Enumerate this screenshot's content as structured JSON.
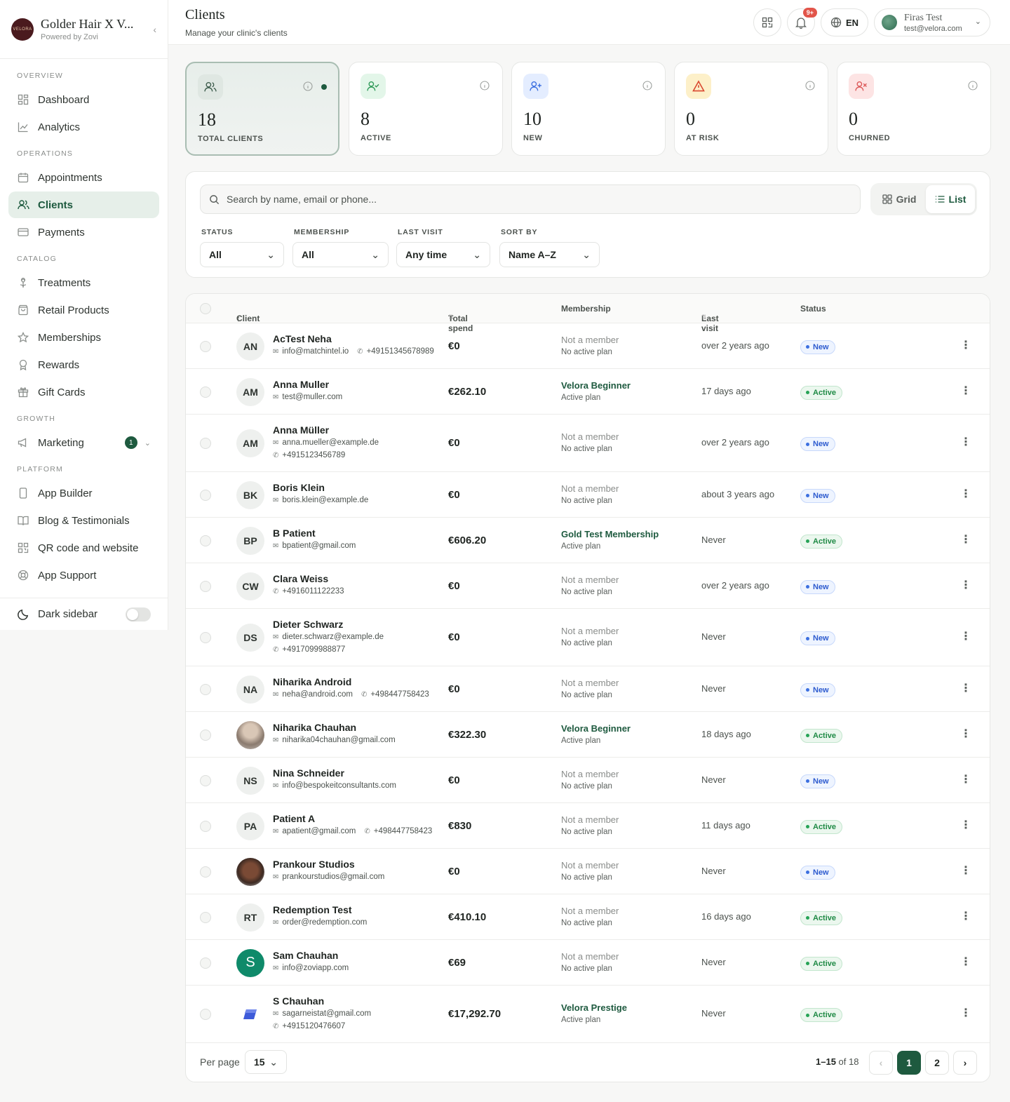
{
  "brand": {
    "logo_text": "VELORA",
    "name": "Golder Hair X V...",
    "sub": "Powered by Zovi"
  },
  "nav": {
    "overview": "OVERVIEW",
    "dashboard": "Dashboard",
    "analytics": "Analytics",
    "operations": "OPERATIONS",
    "appointments": "Appointments",
    "clients": "Clients",
    "payments": "Payments",
    "catalog": "CATALOG",
    "treatments": "Treatments",
    "retail": "Retail Products",
    "memberships": "Memberships",
    "rewards": "Rewards",
    "giftcards": "Gift Cards",
    "growth": "GROWTH",
    "marketing": "Marketing",
    "marketing_badge": "1",
    "platform": "PLATFORM",
    "appbuilder": "App Builder",
    "blog": "Blog & Testimonials",
    "qr": "QR code and website",
    "support": "App Support",
    "dark_sidebar": "Dark sidebar"
  },
  "header": {
    "title": "Clients",
    "subtitle": "Manage your clinic's clients",
    "notif_badge": "9+",
    "lang": "EN",
    "user_name": "Firas Test",
    "user_email": "test@velora.com"
  },
  "stats": [
    {
      "value": "18",
      "label": "TOTAL CLIENTS"
    },
    {
      "value": "8",
      "label": "ACTIVE"
    },
    {
      "value": "10",
      "label": "NEW"
    },
    {
      "value": "0",
      "label": "AT RISK"
    },
    {
      "value": "0",
      "label": "CHURNED"
    }
  ],
  "filters": {
    "search_placeholder": "Search by name, email or phone...",
    "grid_label": "Grid",
    "list_label": "List",
    "status_label": "STATUS",
    "status_value": "All",
    "membership_label": "MEMBERSHIP",
    "membership_value": "All",
    "lastvisit_label": "LAST VISIT",
    "lastvisit_value": "Any time",
    "sort_label": "SORT BY",
    "sort_value": "Name A–Z"
  },
  "table": {
    "headers": {
      "client": "Client",
      "spend": "Total spend",
      "membership": "Membership",
      "last_visit": "Last visit",
      "status": "Status"
    },
    "rows": [
      {
        "initials": "AN",
        "name": "AcTest Neha",
        "email": "info@matchintel.io",
        "phone": "+49151345678989",
        "spend": "€0",
        "mem": "Not a member",
        "plan": "No active plan",
        "visit": "over 2 years ago",
        "status": "New"
      },
      {
        "initials": "AM",
        "name": "Anna Muller",
        "email": "test@muller.com",
        "phone": "",
        "spend": "€262.10",
        "mem": "Velora Beginner",
        "plan": "Active plan",
        "visit": "17 days ago",
        "status": "Active"
      },
      {
        "initials": "AM",
        "name": "Anna Müller",
        "email": "anna.mueller@example.de",
        "phone": "+4915123456789",
        "spend": "€0",
        "mem": "Not a member",
        "plan": "No active plan",
        "visit": "over 2 years ago",
        "status": "New"
      },
      {
        "initials": "BK",
        "name": "Boris Klein",
        "email": "boris.klein@example.de",
        "phone": "",
        "spend": "€0",
        "mem": "Not a member",
        "plan": "No active plan",
        "visit": "about 3 years ago",
        "status": "New"
      },
      {
        "initials": "BP",
        "name": "B Patient",
        "email": "bpatient@gmail.com",
        "phone": "",
        "spend": "€606.20",
        "mem": "Gold Test Membership",
        "plan": "Active plan",
        "visit": "Never",
        "status": "Active"
      },
      {
        "initials": "CW",
        "name": "Clara Weiss",
        "email": "",
        "phone": "+4916011122233",
        "spend": "€0",
        "mem": "Not a member",
        "plan": "No active plan",
        "visit": "over 2 years ago",
        "status": "New"
      },
      {
        "initials": "DS",
        "name": "Dieter Schwarz",
        "email": "dieter.schwarz@example.de",
        "phone": "+4917099988877",
        "spend": "€0",
        "mem": "Not a member",
        "plan": "No active plan",
        "visit": "Never",
        "status": "New"
      },
      {
        "initials": "NA",
        "name": "Niharika Android",
        "email": "neha@android.com",
        "phone": "+498447758423",
        "spend": "€0",
        "mem": "Not a member",
        "plan": "No active plan",
        "visit": "Never",
        "status": "New"
      },
      {
        "initials": "",
        "name": "Niharika Chauhan",
        "email": "niharika04chauhan@gmail.com",
        "phone": "",
        "spend": "€322.30",
        "mem": "Velora Beginner",
        "plan": "Active plan",
        "visit": "18 days ago",
        "status": "Active"
      },
      {
        "initials": "NS",
        "name": "Nina Schneider",
        "email": "info@bespokeitconsultants.com",
        "phone": "",
        "spend": "€0",
        "mem": "Not a member",
        "plan": "No active plan",
        "visit": "Never",
        "status": "New"
      },
      {
        "initials": "PA",
        "name": "Patient A",
        "email": "apatient@gmail.com",
        "phone": "+498447758423",
        "spend": "€830",
        "mem": "Not a member",
        "plan": "No active plan",
        "visit": "11 days ago",
        "status": "Active"
      },
      {
        "initials": "",
        "name": "Prankour Studios",
        "email": "prankourstudios@gmail.com",
        "phone": "",
        "spend": "€0",
        "mem": "Not a member",
        "plan": "No active plan",
        "visit": "Never",
        "status": "New"
      },
      {
        "initials": "RT",
        "name": "Redemption Test",
        "email": "order@redemption.com",
        "phone": "",
        "spend": "€410.10",
        "mem": "Not a member",
        "plan": "No active plan",
        "visit": "16 days ago",
        "status": "Active"
      },
      {
        "initials": "S",
        "name": "Sam Chauhan",
        "email": "info@zoviapp.com",
        "phone": "",
        "spend": "€69",
        "mem": "Not a member",
        "plan": "No active plan",
        "visit": "Never",
        "status": "Active"
      },
      {
        "initials": "",
        "name": "S Chauhan",
        "email": "sagarneistat@gmail.com",
        "phone": "+4915120476607",
        "spend": "€17,292.70",
        "mem": "Velora Prestige",
        "plan": "Active plan",
        "visit": "Never",
        "status": "Active"
      }
    ]
  },
  "footer": {
    "per_page_label": "Per page",
    "per_page": "15",
    "range": "1–15",
    "of_label": "of 18",
    "page1": "1",
    "page2": "2"
  },
  "colors": {
    "accent": "#1e5a3f",
    "new": "#3b6fe0",
    "active": "#26a356"
  }
}
